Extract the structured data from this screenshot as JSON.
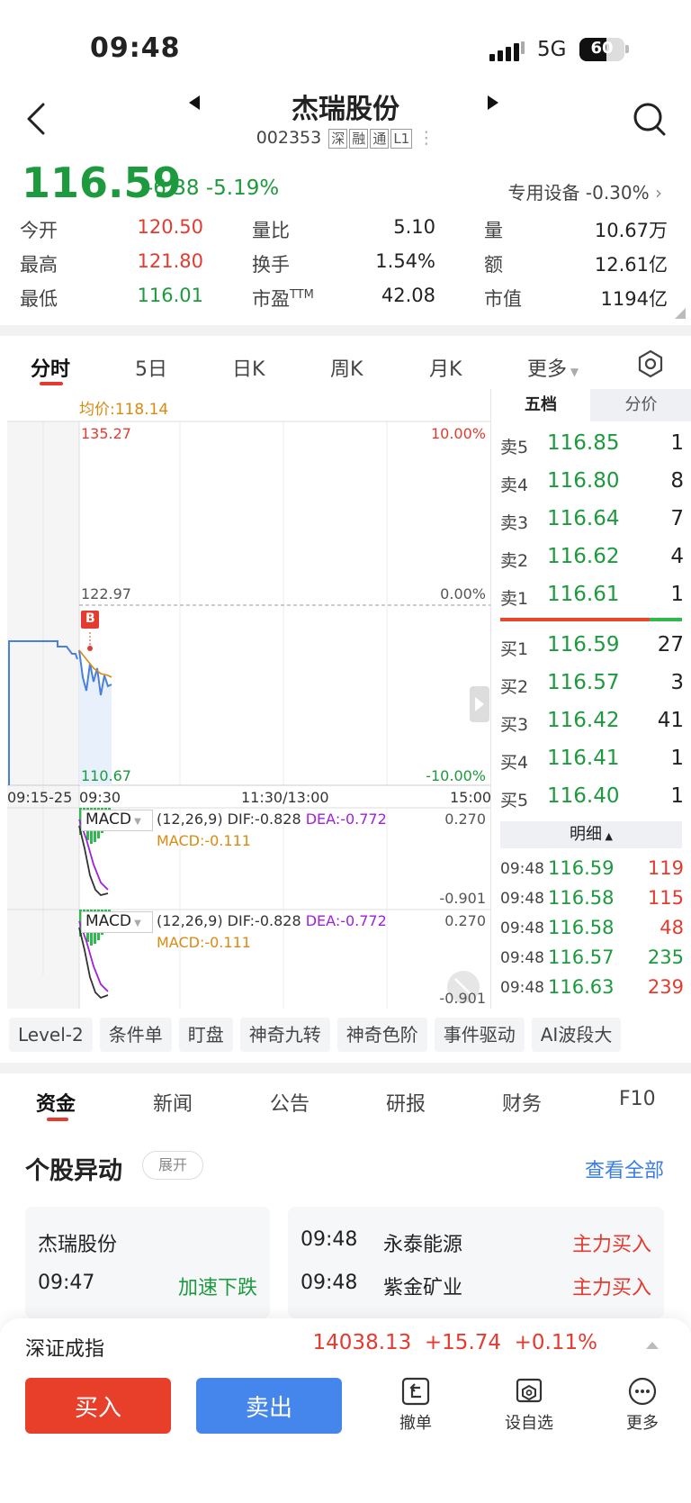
{
  "status": {
    "time": "09:48",
    "network": "5G",
    "battery": "60"
  },
  "header": {
    "title": "杰瑞股份",
    "code": "002353",
    "tags": [
      "深",
      "融",
      "通",
      "L1"
    ]
  },
  "quote": {
    "price": "116.59",
    "change": "-6.38",
    "change_pct": "-5.19%",
    "sector_name": "专用设备",
    "sector_pct": "-0.30%",
    "rows": [
      [
        {
          "label": "今开",
          "value": "120.50"
        },
        {
          "label": "量比",
          "value": "5.10"
        },
        {
          "label": "量",
          "value": "10.67万"
        }
      ],
      [
        {
          "label": "最高",
          "value": "121.80"
        },
        {
          "label": "换手",
          "value": "1.54%"
        },
        {
          "label": "额",
          "value": "12.61亿"
        }
      ],
      [
        {
          "label": "最低",
          "value": "116.01"
        },
        {
          "label": "市盈",
          "value": "42.08",
          "sup": "TTM"
        },
        {
          "label": "市值",
          "value": "1194亿"
        }
      ]
    ]
  },
  "chart_tabs": [
    "分时",
    "5日",
    "日K",
    "周K",
    "月K",
    "更多"
  ],
  "chart": {
    "avg_price_label": "均价:118.14",
    "y_top": "135.27",
    "y_mid": "122.97",
    "y_bot": "110.67",
    "pct_top": "10.00%",
    "pct_mid": "0.00%",
    "pct_bot": "-10.00%",
    "x_labels": [
      "09:15-25",
      "09:30",
      "11:30/13:00",
      "15:00"
    ],
    "marker": "B",
    "macd_label": "MACD",
    "macd_params": "(12,26,9)",
    "dif": "DIF:-0.828",
    "dea": "DEA:-0.772",
    "macd": "MACD:-0.111",
    "macd_top": "0.270",
    "macd_bot": "-0.901"
  },
  "orderbook": {
    "tabs": [
      "五档",
      "分价"
    ],
    "sells": [
      {
        "label": "卖5",
        "price": "116.85",
        "vol": "1"
      },
      {
        "label": "卖4",
        "price": "116.80",
        "vol": "8"
      },
      {
        "label": "卖3",
        "price": "116.64",
        "vol": "7"
      },
      {
        "label": "卖2",
        "price": "116.62",
        "vol": "4"
      },
      {
        "label": "卖1",
        "price": "116.61",
        "vol": "1"
      }
    ],
    "buys": [
      {
        "label": "买1",
        "price": "116.59",
        "vol": "27"
      },
      {
        "label": "买2",
        "price": "116.57",
        "vol": "3"
      },
      {
        "label": "买3",
        "price": "116.42",
        "vol": "41"
      },
      {
        "label": "买4",
        "price": "116.41",
        "vol": "1"
      },
      {
        "label": "买5",
        "price": "116.40",
        "vol": "1"
      }
    ],
    "detail_label": "明细",
    "trades": [
      {
        "time": "09:48",
        "price": "116.59",
        "vol": "119"
      },
      {
        "time": "09:48",
        "price": "116.58",
        "vol": "115"
      },
      {
        "time": "09:48",
        "price": "116.58",
        "vol": "48"
      },
      {
        "time": "09:48",
        "price": "116.57",
        "vol": "235"
      },
      {
        "time": "09:48",
        "price": "116.63",
        "vol": "239"
      }
    ]
  },
  "chips": [
    "Level-2",
    "条件单",
    "盯盘",
    "神奇九转",
    "神奇色阶",
    "事件驱动",
    "AI波段大"
  ],
  "info_tabs": [
    "资金",
    "新闻",
    "公告",
    "研报",
    "财务",
    "F10"
  ],
  "abnormal": {
    "title": "个股异动",
    "expand": "展开",
    "view_all": "查看全部",
    "left": {
      "name": "杰瑞股份",
      "time": "09:47",
      "event": "加速下跌"
    },
    "right": [
      {
        "time": "09:48",
        "name": "永泰能源",
        "event": "主力买入"
      },
      {
        "time": "09:48",
        "name": "紫金矿业",
        "event": "主力买入"
      }
    ]
  },
  "index": {
    "name": "深证成指",
    "value": "14038.13",
    "change": "+15.74",
    "pct": "+0.11%"
  },
  "actions": {
    "buy": "买入",
    "sell": "卖出",
    "cancel": "撤单",
    "watch": "设自选",
    "more": "更多"
  }
}
